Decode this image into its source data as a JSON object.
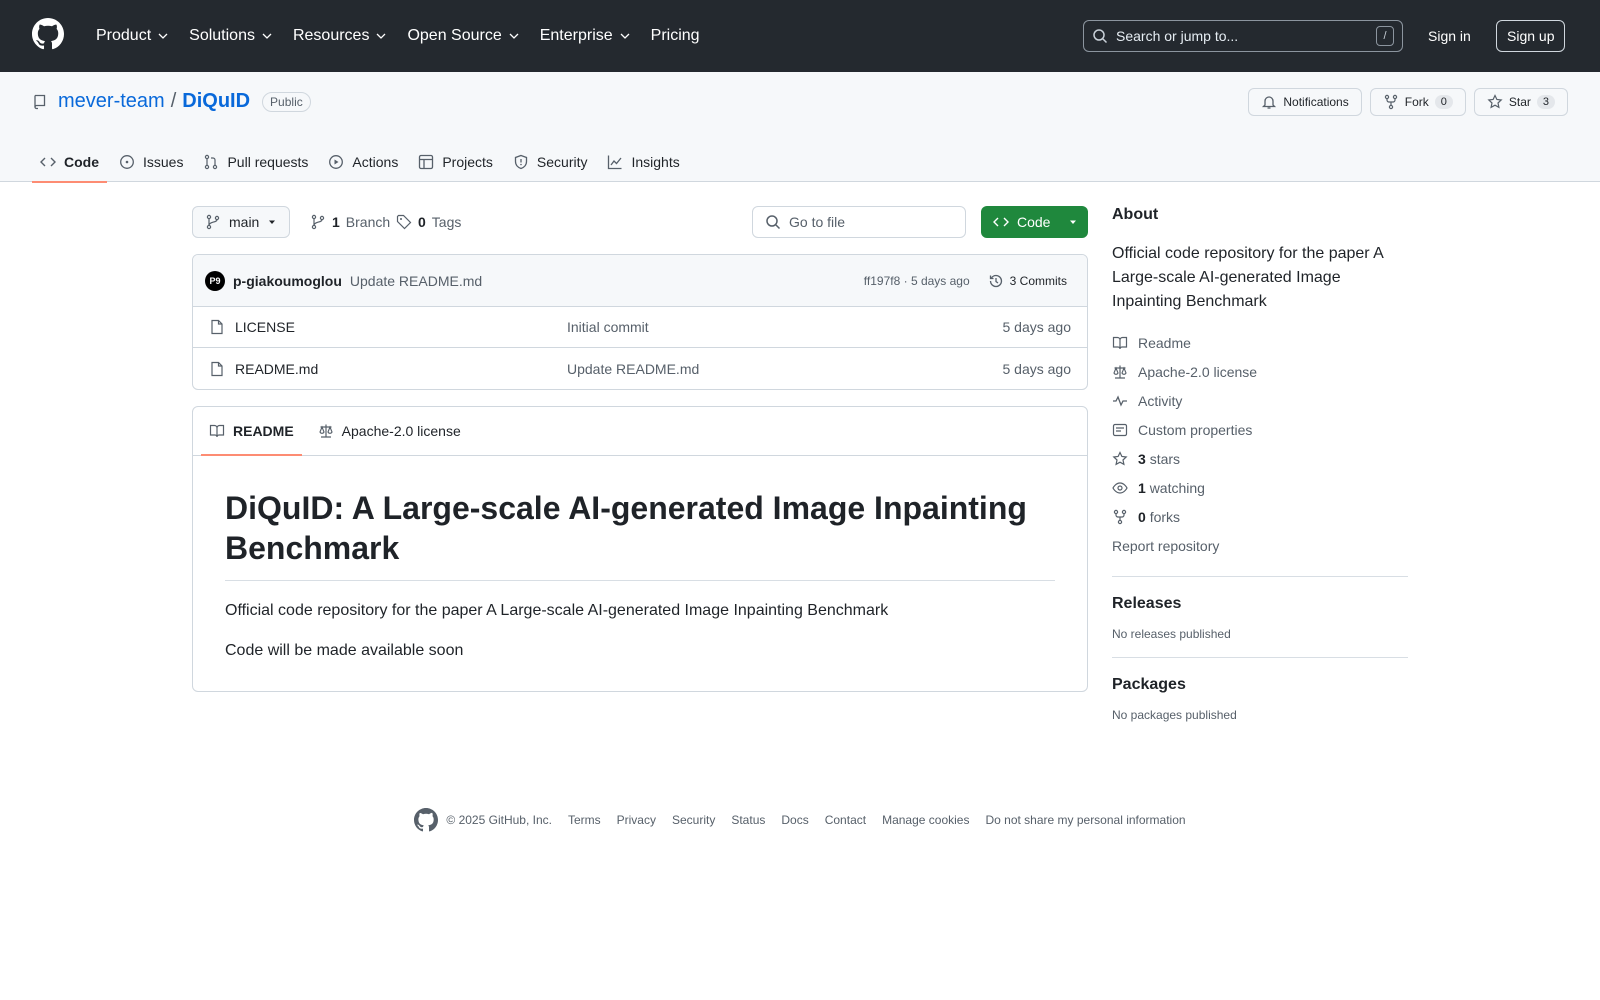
{
  "header": {
    "nav": [
      "Product",
      "Solutions",
      "Resources",
      "Open Source",
      "Enterprise",
      "Pricing"
    ],
    "search_placeholder": "Search or jump to...",
    "search_key": "/",
    "sign_in": "Sign in",
    "sign_up": "Sign up"
  },
  "repo": {
    "owner": "mever-team",
    "separator": "/",
    "name": "DiQuID",
    "visibility": "Public",
    "notifications_label": "Notifications",
    "fork_label": "Fork",
    "fork_count": "0",
    "star_label": "Star",
    "star_count": "3",
    "tabs": [
      "Code",
      "Issues",
      "Pull requests",
      "Actions",
      "Projects",
      "Security",
      "Insights"
    ]
  },
  "toolbar": {
    "branch": "main",
    "branch_count": "1",
    "branch_label": "Branch",
    "tag_count": "0",
    "tag_label": "Tags",
    "goto_placeholder": "Go to file",
    "code_label": "Code"
  },
  "commit": {
    "avatar_text": "P9",
    "author": "p-giakoumoglou",
    "message": "Update README.md",
    "sha_time": "ff197f8 · 5 days ago",
    "commits_label": "3 Commits"
  },
  "files": [
    {
      "name": "LICENSE",
      "message": "Initial commit",
      "date": "5 days ago"
    },
    {
      "name": "README.md",
      "message": "Update README.md",
      "date": "5 days ago"
    }
  ],
  "readme": {
    "tab_readme": "README",
    "tab_license": "Apache-2.0 license",
    "title": "DiQuID: A Large-scale AI-generated Image Inpainting Benchmark",
    "p1": "Official code repository for the paper A Large-scale AI-generated Image Inpainting Benchmark",
    "p2": "Code will be made available soon"
  },
  "about": {
    "heading": "About",
    "description": "Official code repository for the paper A Large-scale AI-generated Image Inpainting Benchmark",
    "readme": "Readme",
    "license": "Apache-2.0 license",
    "activity": "Activity",
    "custom_properties": "Custom properties",
    "stars_count": "3",
    "stars_label": "stars",
    "watching_count": "1",
    "watching_label": "watching",
    "forks_count": "0",
    "forks_label": "forks",
    "report": "Report repository"
  },
  "releases": {
    "heading": "Releases",
    "empty": "No releases published"
  },
  "packages": {
    "heading": "Packages",
    "empty": "No packages published"
  },
  "footer": {
    "copyright": "© 2025 GitHub, Inc.",
    "links": [
      "Terms",
      "Privacy",
      "Security",
      "Status",
      "Docs",
      "Contact",
      "Manage cookies",
      "Do not share my personal information"
    ]
  }
}
